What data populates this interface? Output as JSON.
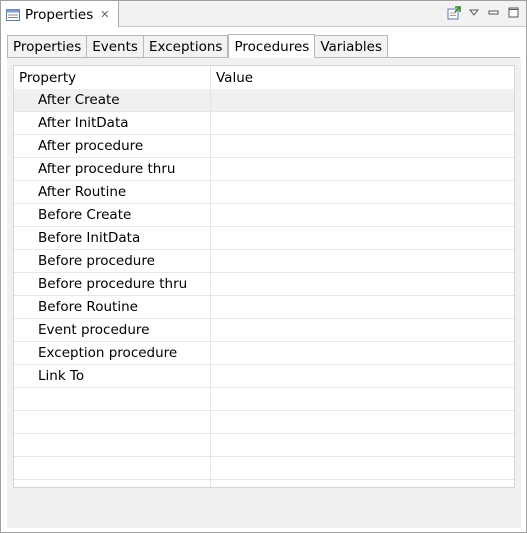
{
  "view": {
    "title": "Properties",
    "close_glyph": "✕",
    "toolbar_icons": [
      "pin-editor-icon",
      "view-menu-icon",
      "minimize-icon",
      "maximize-icon"
    ]
  },
  "tabs": [
    {
      "label": "Properties",
      "active": false
    },
    {
      "label": "Events",
      "active": false
    },
    {
      "label": "Exceptions",
      "active": false
    },
    {
      "label": "Procedures",
      "active": true
    },
    {
      "label": "Variables",
      "active": false
    }
  ],
  "table": {
    "columns": [
      "Property",
      "Value"
    ],
    "rows": [
      {
        "name": "After Create",
        "value": "",
        "selected": true
      },
      {
        "name": "After InitData",
        "value": ""
      },
      {
        "name": "After procedure",
        "value": ""
      },
      {
        "name": "After procedure thru",
        "value": ""
      },
      {
        "name": "After Routine",
        "value": ""
      },
      {
        "name": "Before Create",
        "value": ""
      },
      {
        "name": "Before InitData",
        "value": ""
      },
      {
        "name": "Before procedure",
        "value": ""
      },
      {
        "name": "Before procedure thru",
        "value": ""
      },
      {
        "name": "Before Routine",
        "value": ""
      },
      {
        "name": "Event procedure",
        "value": ""
      },
      {
        "name": "Exception procedure",
        "value": ""
      },
      {
        "name": "Link To",
        "value": ""
      }
    ],
    "empty_rows": 5
  }
}
